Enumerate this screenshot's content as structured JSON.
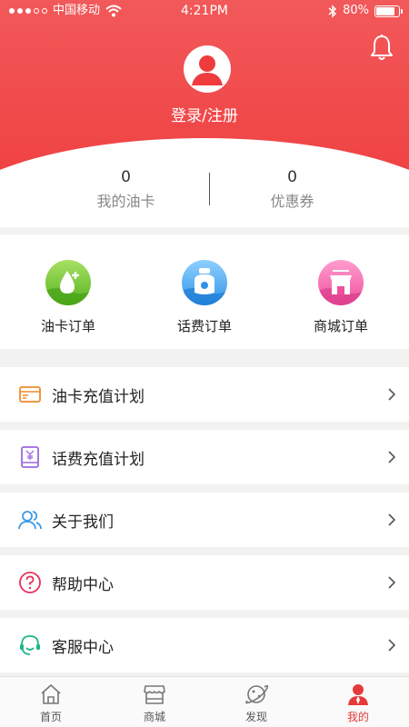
{
  "status_bar": {
    "carrier": "中国移动",
    "time": "4:21PM",
    "battery": "80%",
    "battery_level": 0.8
  },
  "header": {
    "login_text": "登录/注册",
    "colors": {
      "brand_red": "#ef3b3c",
      "accent": "#e63a3a"
    }
  },
  "stats": [
    {
      "value": "0",
      "label": "我的油卡"
    },
    {
      "value": "0",
      "label": "优惠券"
    }
  ],
  "orders": [
    {
      "label": "油卡订单",
      "icon": "oil-drop-icon",
      "color": "#6fcf3a"
    },
    {
      "label": "话费订单",
      "icon": "phone-bill-icon",
      "color": "#3fa3f0"
    },
    {
      "label": "商城订单",
      "icon": "shop-icon",
      "color": "#f05aa6"
    }
  ],
  "menu": [
    {
      "label": "油卡充值计划",
      "icon": "card-icon"
    },
    {
      "label": "话费充值计划",
      "icon": "yen-tablet-icon"
    },
    {
      "label": "关于我们",
      "icon": "people-icon"
    },
    {
      "label": "帮助中心",
      "icon": "question-icon"
    },
    {
      "label": "客服中心",
      "icon": "headset-icon"
    }
  ],
  "tabbar": [
    {
      "label": "首页",
      "icon": "home-icon"
    },
    {
      "label": "商城",
      "icon": "store-icon"
    },
    {
      "label": "发现",
      "icon": "planet-icon"
    },
    {
      "label": "我的",
      "icon": "user-icon",
      "active": true
    }
  ]
}
